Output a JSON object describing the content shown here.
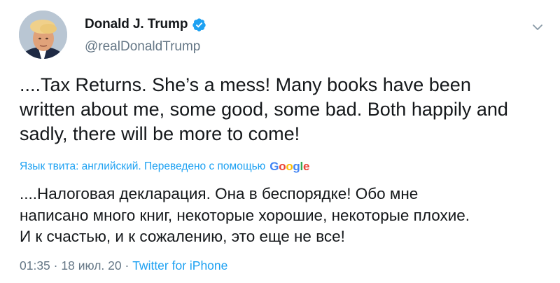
{
  "author": {
    "display_name": "Donald J. Trump",
    "handle": "@realDonaldTrump",
    "verified": true
  },
  "tweet": {
    "text": "....Tax Returns. She’s a mess! Many books have been\nwritten about me, some good, some bad. Both happily and\nsadly, there will be more to come!"
  },
  "translation": {
    "label": "Язык твита: английский. Переведено с помощью",
    "provider_logo": {
      "letters": [
        "G",
        "o",
        "o",
        "g",
        "l",
        "e"
      ],
      "colors": [
        "#4285f4",
        "#ea4335",
        "#fbbc05",
        "#4285f4",
        "#34a853",
        "#ea4335"
      ]
    },
    "text": "....Налоговая декларация. Она в беспорядке! Обо мне\nнаписано много книг, некоторые хорошие, некоторые плохие.\nИ к счастью, и к сожалению, это еще не все!"
  },
  "footer": {
    "time": "01:35",
    "separator": "·",
    "date": "18 июл. 20",
    "source": "Twitter for iPhone"
  },
  "colors": {
    "accent": "#1da1f2",
    "secondary_text": "#657786",
    "primary_text": "#14171a"
  },
  "icons": {
    "verified": "verified-badge-icon",
    "menu": "chevron-down-icon"
  }
}
